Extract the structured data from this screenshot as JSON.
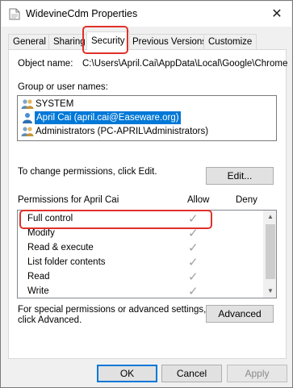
{
  "window": {
    "title": "WidevineCdm Properties",
    "close_glyph": "✕"
  },
  "tabs": [
    {
      "label": "General"
    },
    {
      "label": "Sharing"
    },
    {
      "label": "Security"
    },
    {
      "label": "Previous Versions"
    },
    {
      "label": "Customize"
    }
  ],
  "security": {
    "object_name_label": "Object name:",
    "object_name_value": "C:\\Users\\April.Cai\\AppData\\Local\\Google\\Chrome",
    "group_label": "Group or user names:",
    "users": [
      {
        "name": "SYSTEM",
        "icon": "users-group-icon"
      },
      {
        "name": "April Cai (april.cai@Easeware.org)",
        "icon": "user-icon",
        "selected": true
      },
      {
        "name": "Administrators (PC-APRIL\\Administrators)",
        "icon": "users-group-icon"
      }
    ],
    "change_hint": "To change permissions, click Edit.",
    "edit_button": "Edit...",
    "permissions_label": "Permissions for April Cai",
    "allow_header": "Allow",
    "deny_header": "Deny",
    "permissions": [
      {
        "name": "Full control",
        "allow": true,
        "deny": false
      },
      {
        "name": "Modify",
        "allow": true,
        "deny": false
      },
      {
        "name": "Read & execute",
        "allow": true,
        "deny": false
      },
      {
        "name": "List folder contents",
        "allow": true,
        "deny": false
      },
      {
        "name": "Read",
        "allow": true,
        "deny": false
      },
      {
        "name": "Write",
        "allow": true,
        "deny": false
      }
    ],
    "check_glyph": "✓",
    "special_hint_line1": "For special permissions or advanced settings,",
    "special_hint_line2": "click Advanced.",
    "advanced_button": "Advanced"
  },
  "footer": {
    "ok": "OK",
    "cancel": "Cancel",
    "apply": "Apply"
  },
  "colors": {
    "highlight": "#e0312a",
    "selection": "#0078d7"
  }
}
